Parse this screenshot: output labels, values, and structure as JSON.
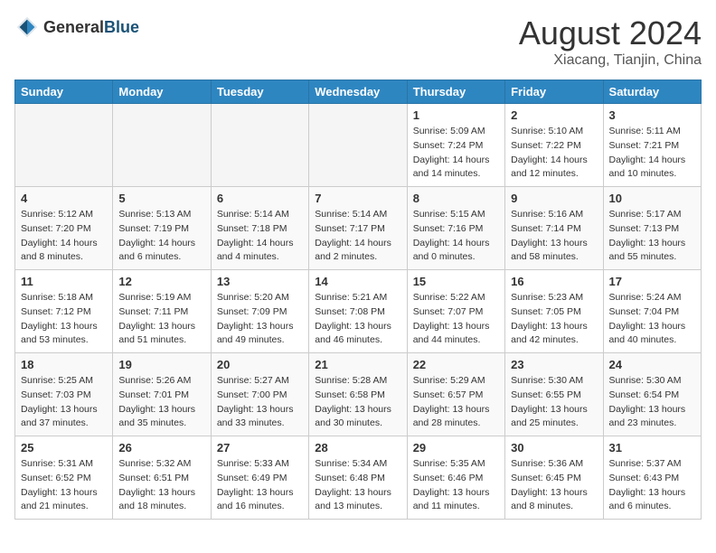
{
  "header": {
    "logo_general": "General",
    "logo_blue": "Blue",
    "month": "August 2024",
    "location": "Xiacang, Tianjin, China"
  },
  "weekdays": [
    "Sunday",
    "Monday",
    "Tuesday",
    "Wednesday",
    "Thursday",
    "Friday",
    "Saturday"
  ],
  "weeks": [
    [
      {
        "day": "",
        "info": ""
      },
      {
        "day": "",
        "info": ""
      },
      {
        "day": "",
        "info": ""
      },
      {
        "day": "",
        "info": ""
      },
      {
        "day": "1",
        "info": "Sunrise: 5:09 AM\nSunset: 7:24 PM\nDaylight: 14 hours and 14 minutes."
      },
      {
        "day": "2",
        "info": "Sunrise: 5:10 AM\nSunset: 7:22 PM\nDaylight: 14 hours and 12 minutes."
      },
      {
        "day": "3",
        "info": "Sunrise: 5:11 AM\nSunset: 7:21 PM\nDaylight: 14 hours and 10 minutes."
      }
    ],
    [
      {
        "day": "4",
        "info": "Sunrise: 5:12 AM\nSunset: 7:20 PM\nDaylight: 14 hours and 8 minutes."
      },
      {
        "day": "5",
        "info": "Sunrise: 5:13 AM\nSunset: 7:19 PM\nDaylight: 14 hours and 6 minutes."
      },
      {
        "day": "6",
        "info": "Sunrise: 5:14 AM\nSunset: 7:18 PM\nDaylight: 14 hours and 4 minutes."
      },
      {
        "day": "7",
        "info": "Sunrise: 5:14 AM\nSunset: 7:17 PM\nDaylight: 14 hours and 2 minutes."
      },
      {
        "day": "8",
        "info": "Sunrise: 5:15 AM\nSunset: 7:16 PM\nDaylight: 14 hours and 0 minutes."
      },
      {
        "day": "9",
        "info": "Sunrise: 5:16 AM\nSunset: 7:14 PM\nDaylight: 13 hours and 58 minutes."
      },
      {
        "day": "10",
        "info": "Sunrise: 5:17 AM\nSunset: 7:13 PM\nDaylight: 13 hours and 55 minutes."
      }
    ],
    [
      {
        "day": "11",
        "info": "Sunrise: 5:18 AM\nSunset: 7:12 PM\nDaylight: 13 hours and 53 minutes."
      },
      {
        "day": "12",
        "info": "Sunrise: 5:19 AM\nSunset: 7:11 PM\nDaylight: 13 hours and 51 minutes."
      },
      {
        "day": "13",
        "info": "Sunrise: 5:20 AM\nSunset: 7:09 PM\nDaylight: 13 hours and 49 minutes."
      },
      {
        "day": "14",
        "info": "Sunrise: 5:21 AM\nSunset: 7:08 PM\nDaylight: 13 hours and 46 minutes."
      },
      {
        "day": "15",
        "info": "Sunrise: 5:22 AM\nSunset: 7:07 PM\nDaylight: 13 hours and 44 minutes."
      },
      {
        "day": "16",
        "info": "Sunrise: 5:23 AM\nSunset: 7:05 PM\nDaylight: 13 hours and 42 minutes."
      },
      {
        "day": "17",
        "info": "Sunrise: 5:24 AM\nSunset: 7:04 PM\nDaylight: 13 hours and 40 minutes."
      }
    ],
    [
      {
        "day": "18",
        "info": "Sunrise: 5:25 AM\nSunset: 7:03 PM\nDaylight: 13 hours and 37 minutes."
      },
      {
        "day": "19",
        "info": "Sunrise: 5:26 AM\nSunset: 7:01 PM\nDaylight: 13 hours and 35 minutes."
      },
      {
        "day": "20",
        "info": "Sunrise: 5:27 AM\nSunset: 7:00 PM\nDaylight: 13 hours and 33 minutes."
      },
      {
        "day": "21",
        "info": "Sunrise: 5:28 AM\nSunset: 6:58 PM\nDaylight: 13 hours and 30 minutes."
      },
      {
        "day": "22",
        "info": "Sunrise: 5:29 AM\nSunset: 6:57 PM\nDaylight: 13 hours and 28 minutes."
      },
      {
        "day": "23",
        "info": "Sunrise: 5:30 AM\nSunset: 6:55 PM\nDaylight: 13 hours and 25 minutes."
      },
      {
        "day": "24",
        "info": "Sunrise: 5:30 AM\nSunset: 6:54 PM\nDaylight: 13 hours and 23 minutes."
      }
    ],
    [
      {
        "day": "25",
        "info": "Sunrise: 5:31 AM\nSunset: 6:52 PM\nDaylight: 13 hours and 21 minutes."
      },
      {
        "day": "26",
        "info": "Sunrise: 5:32 AM\nSunset: 6:51 PM\nDaylight: 13 hours and 18 minutes."
      },
      {
        "day": "27",
        "info": "Sunrise: 5:33 AM\nSunset: 6:49 PM\nDaylight: 13 hours and 16 minutes."
      },
      {
        "day": "28",
        "info": "Sunrise: 5:34 AM\nSunset: 6:48 PM\nDaylight: 13 hours and 13 minutes."
      },
      {
        "day": "29",
        "info": "Sunrise: 5:35 AM\nSunset: 6:46 PM\nDaylight: 13 hours and 11 minutes."
      },
      {
        "day": "30",
        "info": "Sunrise: 5:36 AM\nSunset: 6:45 PM\nDaylight: 13 hours and 8 minutes."
      },
      {
        "day": "31",
        "info": "Sunrise: 5:37 AM\nSunset: 6:43 PM\nDaylight: 13 hours and 6 minutes."
      }
    ]
  ]
}
